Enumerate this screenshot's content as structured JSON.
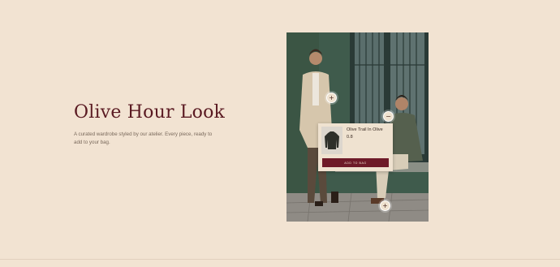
{
  "section": {
    "title": "Olive Hour Look",
    "description": "A curated wardrobe styled by our atelier. Every piece, ready to add to your bag."
  },
  "hotspots": [
    {
      "label": "+",
      "state": "closed"
    },
    {
      "label": "−",
      "state": "open"
    },
    {
      "label": "+",
      "state": "closed"
    }
  ],
  "product_card": {
    "name": "Olive Trail In Olive",
    "price": "0.8",
    "button_label": "ADD TO BAG"
  },
  "colors": {
    "background": "#f2e3d2",
    "title": "#5a1a22",
    "accent_button": "#6e1a28",
    "wall": "#3d5a4b"
  },
  "icons": [
    "plus-icon",
    "minus-icon"
  ]
}
